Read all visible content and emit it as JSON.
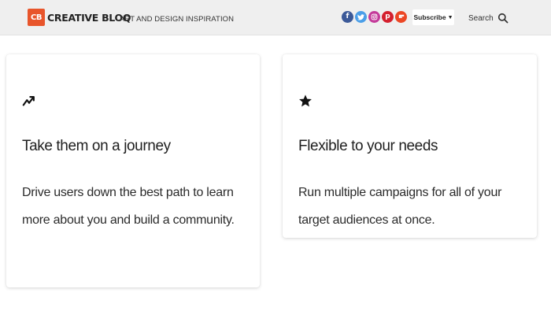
{
  "header": {
    "logo_badge": "CB",
    "logo_text": "CREATIVE BLOQ",
    "tagline": "ART AND DESIGN INSPIRATION",
    "socials": [
      {
        "icon": "facebook-icon",
        "glyph": "f"
      },
      {
        "icon": "twitter-icon",
        "glyph": "t"
      },
      {
        "icon": "instagram-icon",
        "glyph": "◎"
      },
      {
        "icon": "pinterest-icon",
        "glyph": "p"
      },
      {
        "icon": "flipboard-icon",
        "glyph": "f"
      }
    ],
    "subscribe_label": "Subscribe",
    "subscribe_caret": "▼",
    "search_label": "Search",
    "brand_color": "#e8552b"
  },
  "cards": [
    {
      "icon": "trending-arrow-icon",
      "title": "Take them on a journey",
      "body": "Drive users down the best path to learn more about you and build a community."
    },
    {
      "icon": "star-icon",
      "title": "Flexible to your needs",
      "body": "Run multiple campaigns for all of your target audiences at once."
    }
  ]
}
